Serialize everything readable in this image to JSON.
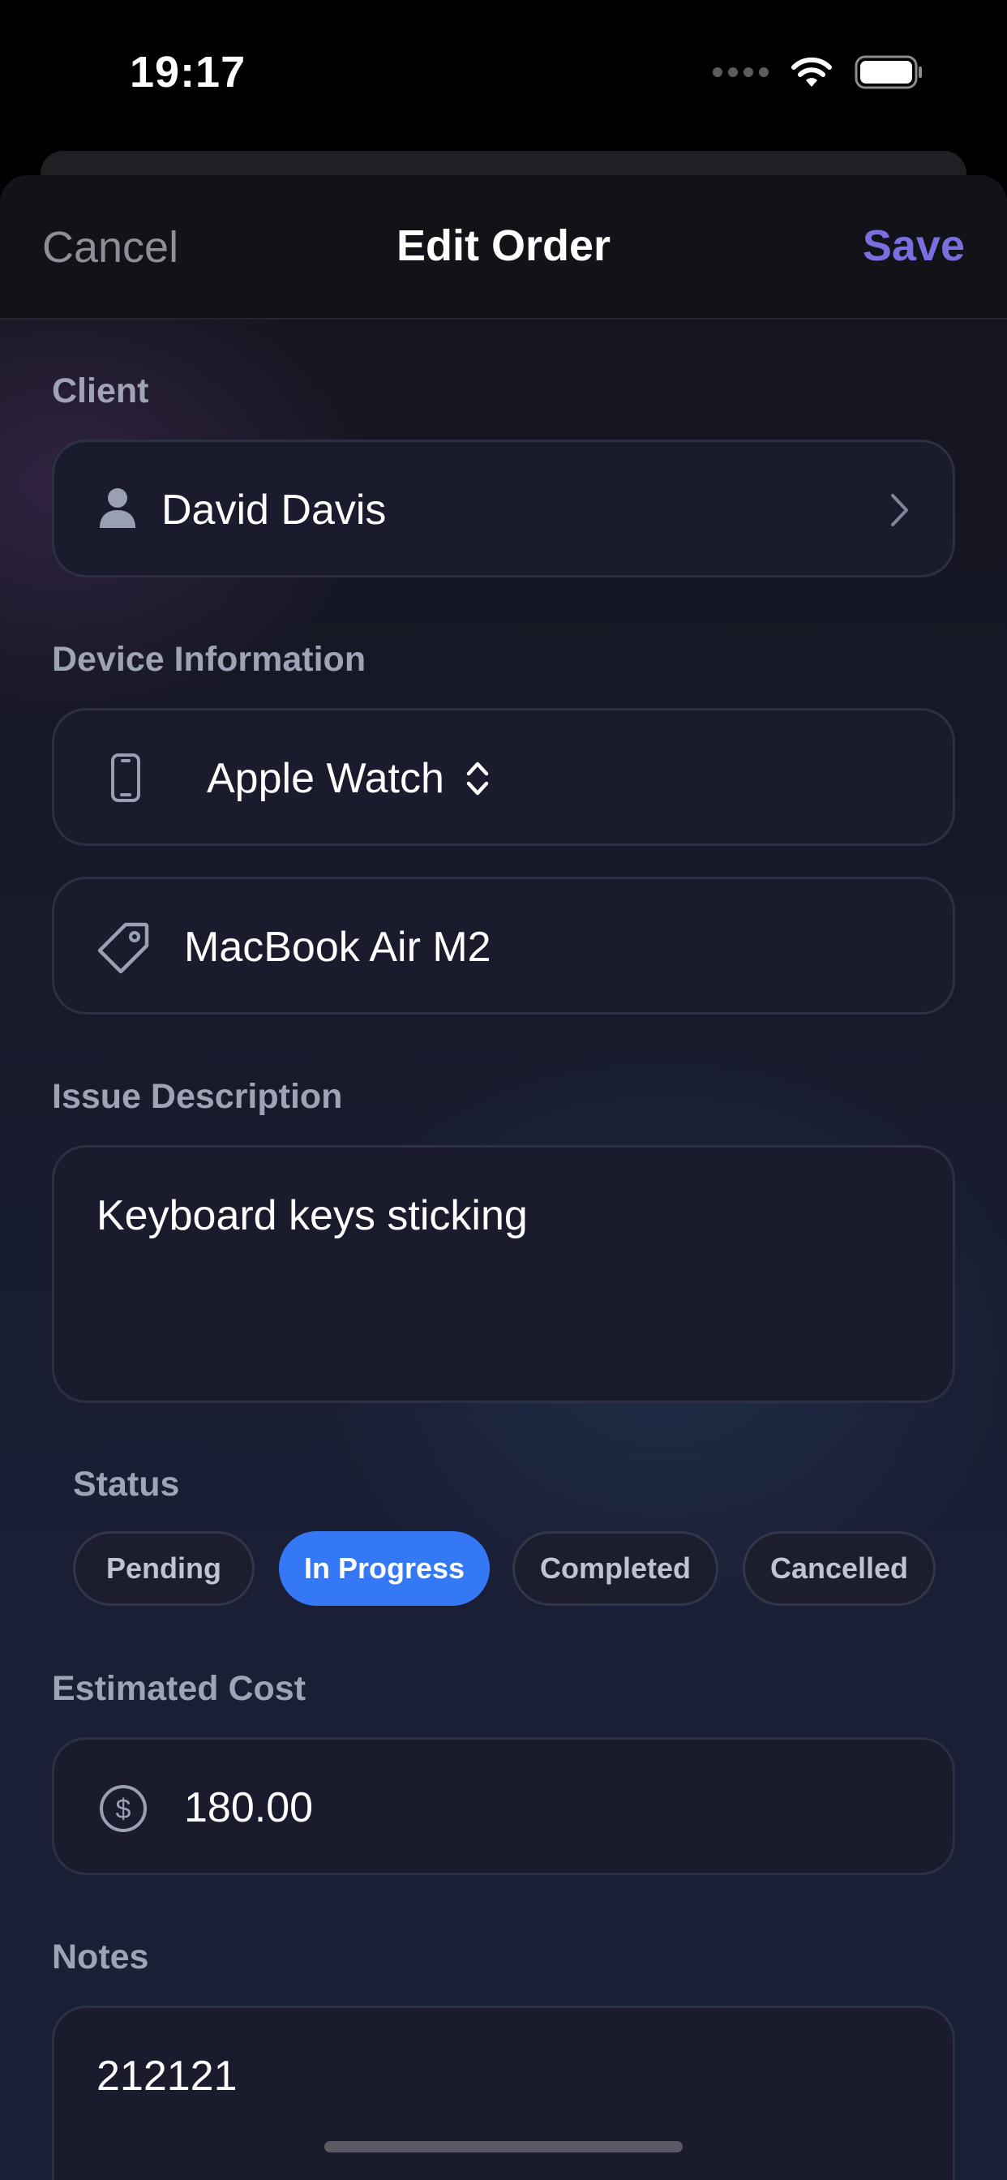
{
  "status_bar": {
    "time": "19:17"
  },
  "nav": {
    "cancel_label": "Cancel",
    "title": "Edit Order",
    "save_label": "Save"
  },
  "client": {
    "label": "Client",
    "name": "David Davis"
  },
  "device": {
    "label": "Device Information",
    "type": "Apple Watch",
    "model": "MacBook Air M2"
  },
  "issue": {
    "label": "Issue Description",
    "text": "Keyboard keys sticking"
  },
  "status": {
    "label": "Status",
    "options": [
      "Pending",
      "In Progress",
      "Completed",
      "Cancelled"
    ],
    "selected": "In Progress"
  },
  "cost": {
    "label": "Estimated Cost",
    "value": "180.00"
  },
  "notes": {
    "label": "Notes",
    "text": "212121"
  },
  "colors": {
    "accent_save": "#7b6fe0",
    "chip_active": "#3478f6",
    "background": "#1a1f36"
  },
  "icons": [
    "person-icon",
    "chevron-right-icon",
    "phone-icon",
    "up-down-chevron-icon",
    "tag-icon",
    "dollar-circle-icon",
    "wifi-icon",
    "battery-icon"
  ]
}
